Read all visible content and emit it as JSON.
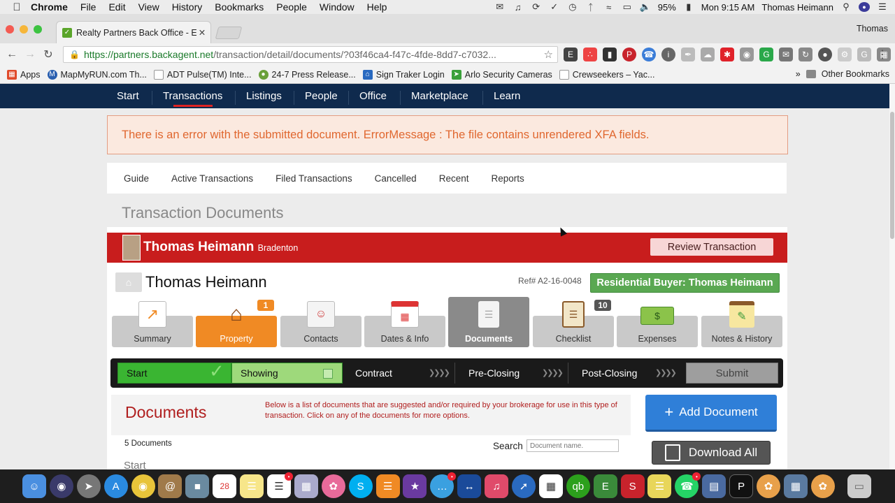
{
  "mac_menubar": {
    "app": "Chrome",
    "items": [
      "File",
      "Edit",
      "View",
      "History",
      "Bookmarks",
      "People",
      "Window",
      "Help"
    ],
    "battery": "95%",
    "datetime": "Mon 9:15 AM",
    "user": "Thomas Heimann"
  },
  "browser": {
    "tab_title": "Realty Partners Back Office - E",
    "profile": "Thomas",
    "url_host": "https://partners.backagent.net",
    "url_path": "/transaction/detail/documents/?03f46ca4-f47c-4fde-8dd7-c7032...",
    "bookmarks": [
      {
        "label": "Apps",
        "icon": "apps-grid-icon",
        "color": "#e04a2a"
      },
      {
        "label": "MapMyRUN.com Th...",
        "icon": "mapmyrun-icon",
        "color": "#2a5fb0"
      },
      {
        "label": "ADT Pulse(TM) Inte...",
        "icon": "page-icon",
        "color": "#aaaaaa"
      },
      {
        "label": "24-7 Press Release...",
        "icon": "press-release-icon",
        "color": "#6aa03a"
      },
      {
        "label": "Sign Traker Login",
        "icon": "sign-traker-icon",
        "color": "#2a6ac0"
      },
      {
        "label": "Arlo Security Cameras",
        "icon": "arlo-icon",
        "color": "#3aa03a"
      },
      {
        "label": "Crewseekers – Yac...",
        "icon": "page-icon",
        "color": "#aaaaaa"
      }
    ],
    "other_bookmarks": "Other Bookmarks"
  },
  "site_nav": {
    "items": [
      "Start",
      "Transactions",
      "Listings",
      "People",
      "Office",
      "Marketplace",
      "Learn"
    ],
    "active": "Transactions"
  },
  "error_message": "There is an error with the submitted document. ErrorMessage : The file contains unrendered XFA fields.",
  "sub_nav": [
    "Guide",
    "Active Transactions",
    "Filed Transactions",
    "Cancelled",
    "Recent",
    "Reports"
  ],
  "page_heading": "Transaction Documents",
  "agent": {
    "name": "Thomas Heimann",
    "city": "Bradenton",
    "review_button": "Review Transaction"
  },
  "transaction": {
    "client_name": "Thomas Heimann",
    "ref": "Ref# A2-16-0048",
    "type_badge": "Residential Buyer: Thomas Heimann"
  },
  "tiles": [
    {
      "label": "Summary",
      "icon": "chart-icon",
      "state": "normal",
      "count": ""
    },
    {
      "label": "Property",
      "icon": "house-icon",
      "state": "active",
      "count": "1"
    },
    {
      "label": "Contacts",
      "icon": "contacts-card-icon",
      "state": "normal",
      "count": ""
    },
    {
      "label": "Dates & Info",
      "icon": "calendar-icon",
      "state": "normal",
      "count": ""
    },
    {
      "label": "Documents",
      "icon": "document-icon",
      "state": "current",
      "count": ""
    },
    {
      "label": "Checklist",
      "icon": "clipboard-icon",
      "state": "normal",
      "count": "10"
    },
    {
      "label": "Expenses",
      "icon": "money-icon",
      "state": "normal",
      "count": ""
    },
    {
      "label": "Notes & History",
      "icon": "notepad-icon",
      "state": "normal",
      "count": ""
    }
  ],
  "stages": {
    "start": "Start",
    "showing": "Showing",
    "contract": "Contract",
    "pre_closing": "Pre-Closing",
    "post_closing": "Post-Closing",
    "submit": "Submit"
  },
  "documents": {
    "title": "Documents",
    "description": "Below is a list of documents that are suggested and/or required by your brokerage for use in this type of transaction. Click on any of the documents for more options.",
    "add_button": "Add Document",
    "download_button": "Download All",
    "count": "5 Documents",
    "search_label": "Search",
    "search_placeholder": "Document name.",
    "section": "Start"
  },
  "dock_badges": {
    "calendar_day": "28",
    "calendar_month": "NOV"
  }
}
